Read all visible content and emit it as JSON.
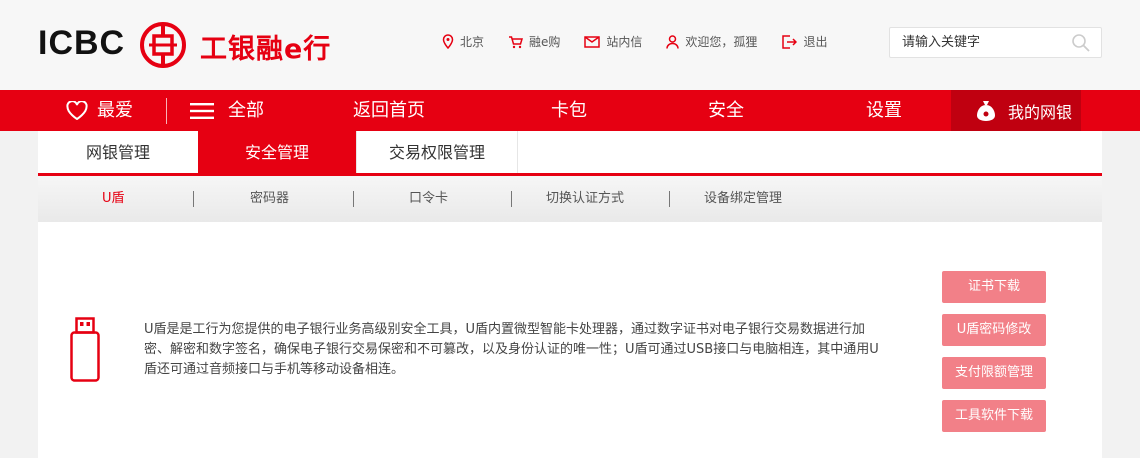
{
  "header": {
    "logo_text": "ICBC",
    "logo_cn": "工银融e行",
    "links": [
      {
        "icon": "location-pin-icon",
        "label": "北京"
      },
      {
        "icon": "cart-icon",
        "label": "融e购"
      },
      {
        "icon": "mail-icon",
        "label": "站内信"
      },
      {
        "icon": "user-icon",
        "label": "欢迎您，孤狸"
      },
      {
        "icon": "logout-icon",
        "label": "退出"
      }
    ],
    "search_placeholder": "请输入关键字"
  },
  "nav": {
    "favorites": "最爱",
    "all": "全部",
    "home": "返回首页",
    "cardbag": "卡包",
    "security": "安全",
    "settings": "设置",
    "my_bank": "我的网银"
  },
  "tabs": [
    "网银管理",
    "安全管理",
    "交易权限管理"
  ],
  "subtabs": [
    "U盾",
    "密码器",
    "口令卡",
    "切换认证方式",
    "设备绑定管理"
  ],
  "content": {
    "description": "U盾是是工行为您提供的电子银行业务高级别安全工具，U盾内置微型智能卡处理器，通过数字证书对电子银行交易数据进行加密、解密和数字签名，确保电子银行交易保密和不可篡改，以及身份认证的唯一性；U盾可通过USB接口与电脑相连，其中通用U盾还可通过音频接口与手机等移动设备相连。",
    "buttons": [
      "证书下载",
      "U盾密码修改",
      "支付限额管理",
      "工具软件下载"
    ]
  },
  "colors": {
    "brand_red": "#e60012",
    "button_pink": "#f28088",
    "nav_dark_red": "#c00010"
  }
}
